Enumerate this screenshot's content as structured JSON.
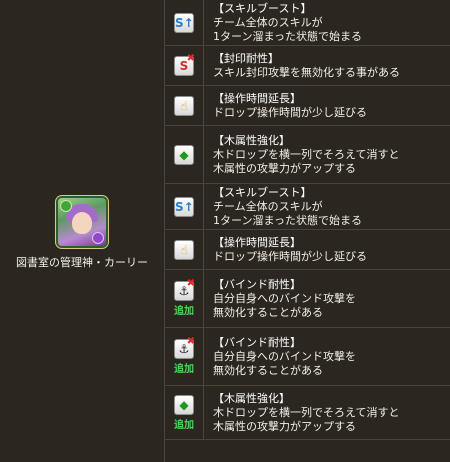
{
  "character": {
    "name": "図書室の管理神・カーリー",
    "portrait_icon": "kali-librarian-portrait"
  },
  "awakenings": [
    {
      "title": "【スキルブースト】",
      "lines": [
        "チーム全体のスキルが",
        "1ターン溜まった状態で始まる"
      ],
      "icon": "skill-boost-icon",
      "kind": "skill",
      "glyph": "S↑",
      "added": false
    },
    {
      "title": "【封印耐性】",
      "lines": [
        "スキル封印攻撃を無効化する事がある"
      ],
      "icon": "seal-resist-icon",
      "kind": "seal",
      "glyph": "S",
      "added": false
    },
    {
      "title": "【操作時間延長】",
      "lines": [
        "ドロップ操作時間が少し延びる"
      ],
      "icon": "time-extend-icon",
      "kind": "time",
      "glyph": "☝",
      "added": false
    },
    {
      "title": "【木属性強化】",
      "lines": [
        "木ドロップを横一列でそろえて消すと",
        "木属性の攻撃力がアップする"
      ],
      "icon": "wood-row-icon",
      "kind": "wood",
      "glyph": "◆",
      "added": false
    },
    {
      "title": "【スキルブースト】",
      "lines": [
        "チーム全体のスキルが",
        "1ターン溜まった状態で始まる"
      ],
      "icon": "skill-boost-icon",
      "kind": "skill",
      "glyph": "S↑",
      "added": false
    },
    {
      "title": "【操作時間延長】",
      "lines": [
        "ドロップ操作時間が少し延びる"
      ],
      "icon": "time-extend-icon",
      "kind": "time",
      "glyph": "☝",
      "added": false
    },
    {
      "title": "【バインド耐性】",
      "lines": [
        "自分自身へのバインド攻撃を",
        "無効化することがある"
      ],
      "icon": "bind-resist-icon",
      "kind": "bind",
      "glyph": "⚓",
      "added": true
    },
    {
      "title": "【バインド耐性】",
      "lines": [
        "自分自身へのバインド攻撃を",
        "無効化することがある"
      ],
      "icon": "bind-resist-icon",
      "kind": "bind",
      "glyph": "⚓",
      "added": true
    },
    {
      "title": "【木属性強化】",
      "lines": [
        "木ドロップを横一列でそろえて消すと",
        "木属性の攻撃力がアップする"
      ],
      "icon": "wood-row-icon",
      "kind": "wood",
      "glyph": "◆",
      "added": true
    }
  ],
  "added_label": "追加"
}
